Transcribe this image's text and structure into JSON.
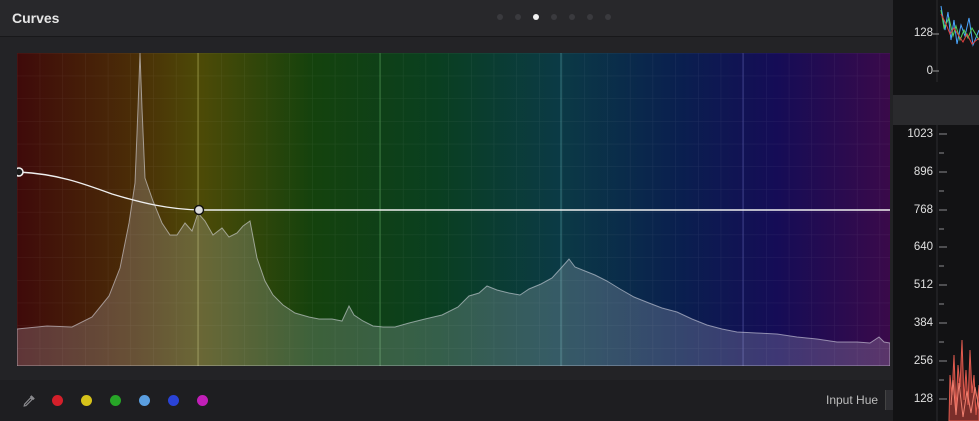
{
  "header": {
    "title": "Curves"
  },
  "pagination": {
    "total": 7,
    "active_index": 2
  },
  "curve_editor": {
    "mode_label": "Input Hue",
    "colors": {
      "swatch_red": "#d41f2a",
      "swatch_yellow": "#d6c21a",
      "swatch_green": "#27a527",
      "swatch_cyan": "#5a9ee0",
      "swatch_blue": "#2a43d6",
      "swatch_magenta": "#c21fb8"
    }
  },
  "scopes": {
    "top_labels": [
      "128",
      "0"
    ],
    "bottom_labels": [
      "1023",
      "896",
      "768",
      "640",
      "512",
      "384",
      "256",
      "128"
    ]
  }
}
